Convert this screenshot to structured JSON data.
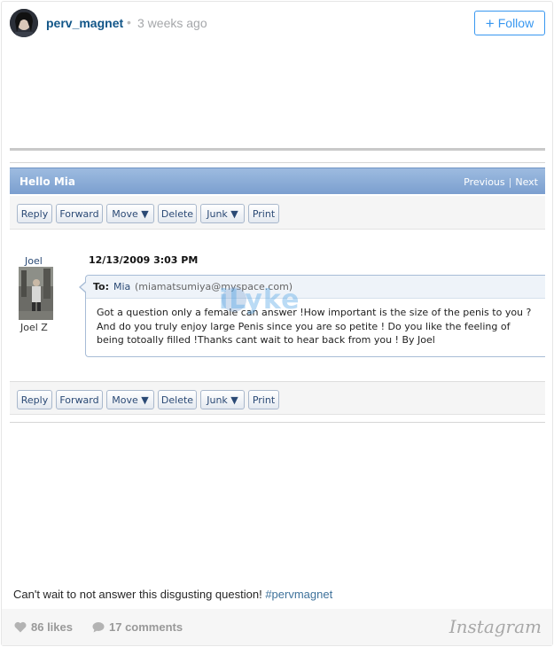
{
  "post": {
    "username": "perv_magnet",
    "separator": "•",
    "time_ago": "3 weeks ago",
    "follow_label": "Follow",
    "follow_plus": "+"
  },
  "mail": {
    "title": "Hello Mia",
    "nav_previous": "Previous",
    "nav_separator": "|",
    "nav_next": "Next",
    "toolbar": [
      "Reply",
      "Forward",
      "Move ▼",
      "Delete",
      "Junk ▼",
      "Print"
    ],
    "sender_name": "Joel",
    "sender_full_name": "Joel Z",
    "date": "12/13/2009 3:03 PM",
    "to_label": "To:",
    "to_name": "Mia",
    "to_email": "(miamatsumiya@myspace.com)",
    "body": "Got a question only a female can answer !How important is the size of the penis to you ?And do you truly enjoy large Penis since you are so petite ! Do you like the feeling of being totoally filled !Thanks cant wait to hear back from you ! By Joel",
    "watermark": "iLyke"
  },
  "caption": {
    "text": "Can't wait to not answer this disgusting question! ",
    "hashtag": "#pervmagnet"
  },
  "stats": {
    "likes": "86 likes",
    "comments": "17 comments",
    "brand": "Instagram"
  },
  "colors": {
    "username": "#125688",
    "follow": "#3897f0",
    "mail_header": "#7b9fcf",
    "hashtag": "#3f729b"
  }
}
